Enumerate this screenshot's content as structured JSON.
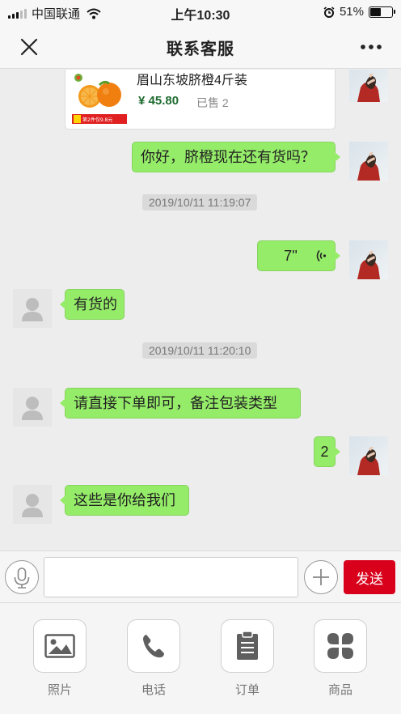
{
  "status_bar": {
    "carrier": "中国联通",
    "time": "上午10:30",
    "battery": "51%",
    "battery_level": 0.51
  },
  "nav": {
    "title": "联系客服"
  },
  "product": {
    "name": "眉山东坡脐橙4斤装",
    "price": "¥ 45.80",
    "sold": "已售 2",
    "promo": "第2件仅9.8元"
  },
  "messages": {
    "m1": "你好，脐橙现在还有货吗？",
    "t1": "2019/10/11 11:19:07",
    "voice": "7''",
    "m2": "有货的",
    "t2": "2019/10/11 11:20:10",
    "m3": "请直接下单即可，备注包装类型",
    "m4": "2",
    "m5": "这些是你给我们"
  },
  "input": {
    "placeholder": "",
    "send_label": "发送"
  },
  "tools": {
    "photo": "照片",
    "phone": "电话",
    "order": "订单",
    "goods": "商品"
  },
  "colors": {
    "bubble": "#95ec69",
    "send": "#d9001b",
    "price": "#1d6b2f"
  }
}
